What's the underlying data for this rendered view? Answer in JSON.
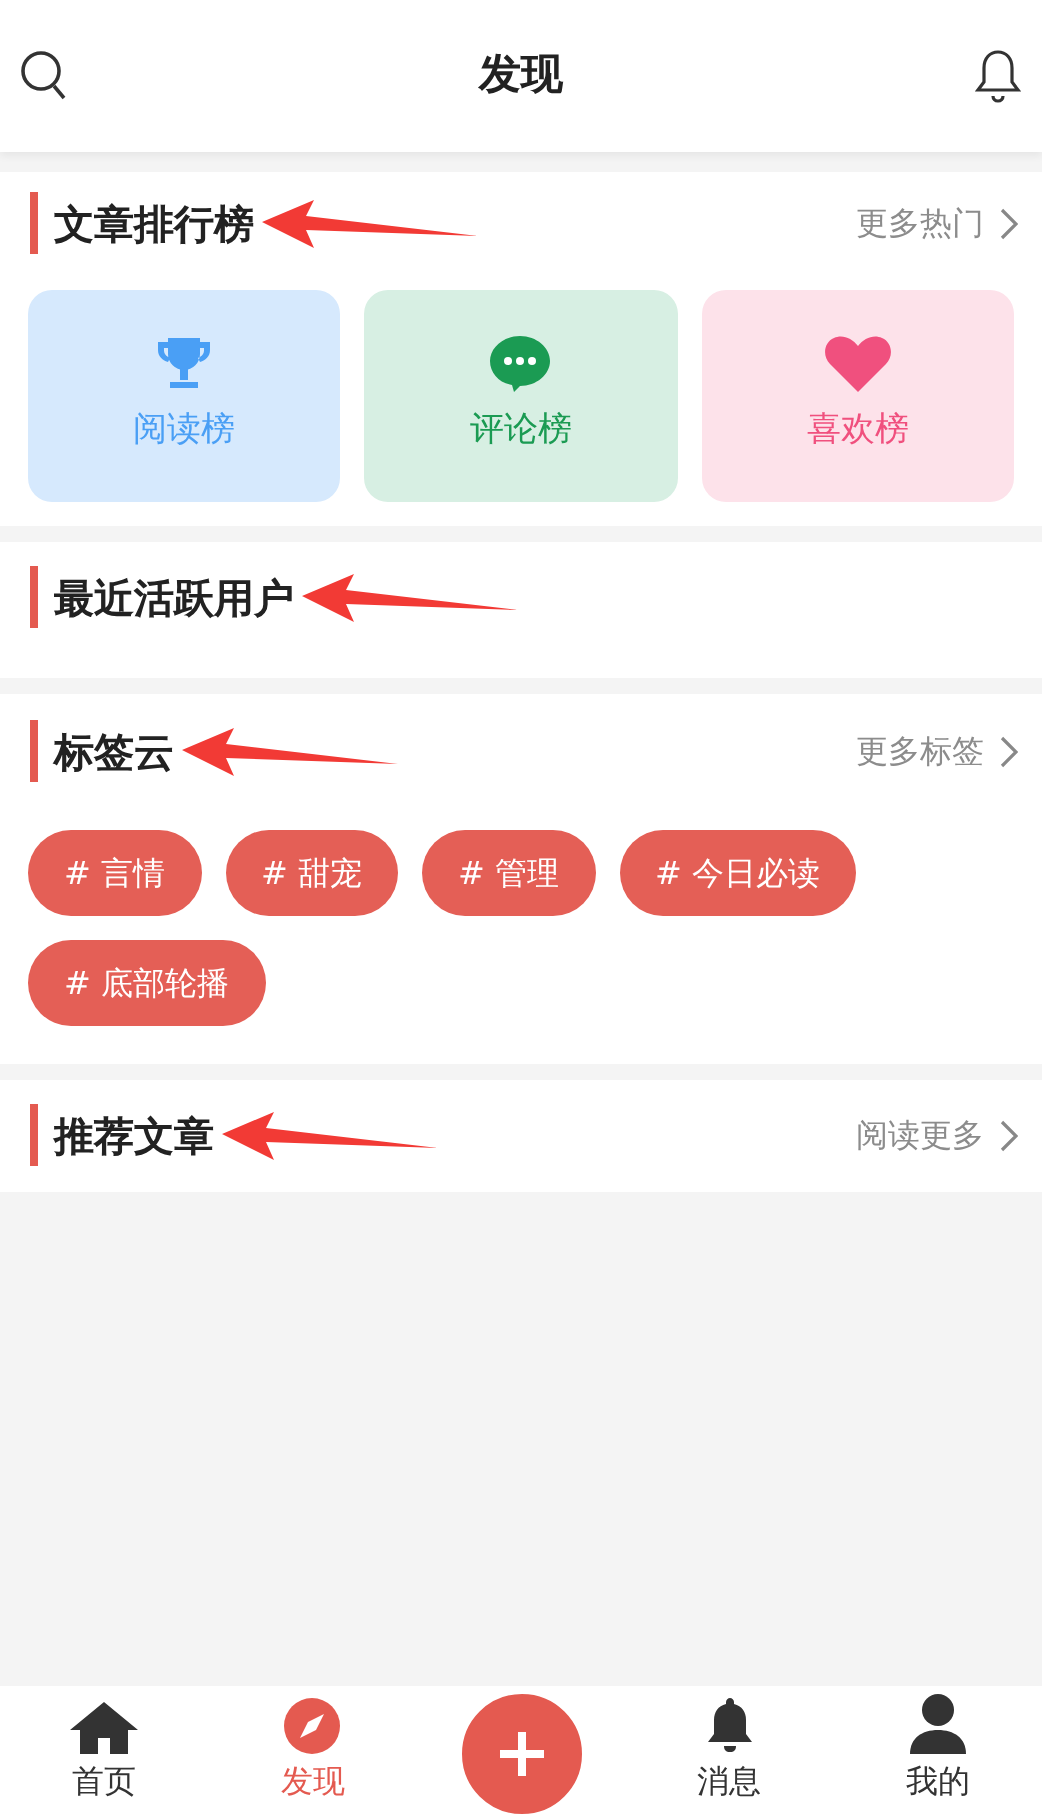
{
  "header": {
    "title": "发现"
  },
  "sections": [
    {
      "kind": "rankings",
      "title": "文章排行榜",
      "annotated": true,
      "more": "更多热门",
      "cards": [
        {
          "kind": "trophy",
          "label": "阅读榜"
        },
        {
          "kind": "chat",
          "label": "评论榜"
        },
        {
          "kind": "heart",
          "label": "喜欢榜"
        }
      ]
    },
    {
      "kind": "users",
      "title": "最近活跃用户",
      "annotated": true
    },
    {
      "kind": "tags",
      "title": "标签云",
      "annotated": true,
      "more": "更多标签",
      "tags": [
        "# 言情",
        "# 甜宠",
        "# 管理",
        "# 今日必读",
        "# 底部轮播"
      ]
    },
    {
      "kind": "articles",
      "title": "推荐文章",
      "annotated": true,
      "more": "阅读更多"
    }
  ],
  "tab_bar": [
    {
      "kind": "home",
      "label": "首页",
      "selected": false
    },
    {
      "kind": "compass",
      "label": "发现",
      "selected": true
    },
    {
      "kind": "add"
    },
    {
      "kind": "bell",
      "label": "消息",
      "selected": false
    },
    {
      "kind": "person",
      "label": "我的",
      "selected": false
    }
  ]
}
